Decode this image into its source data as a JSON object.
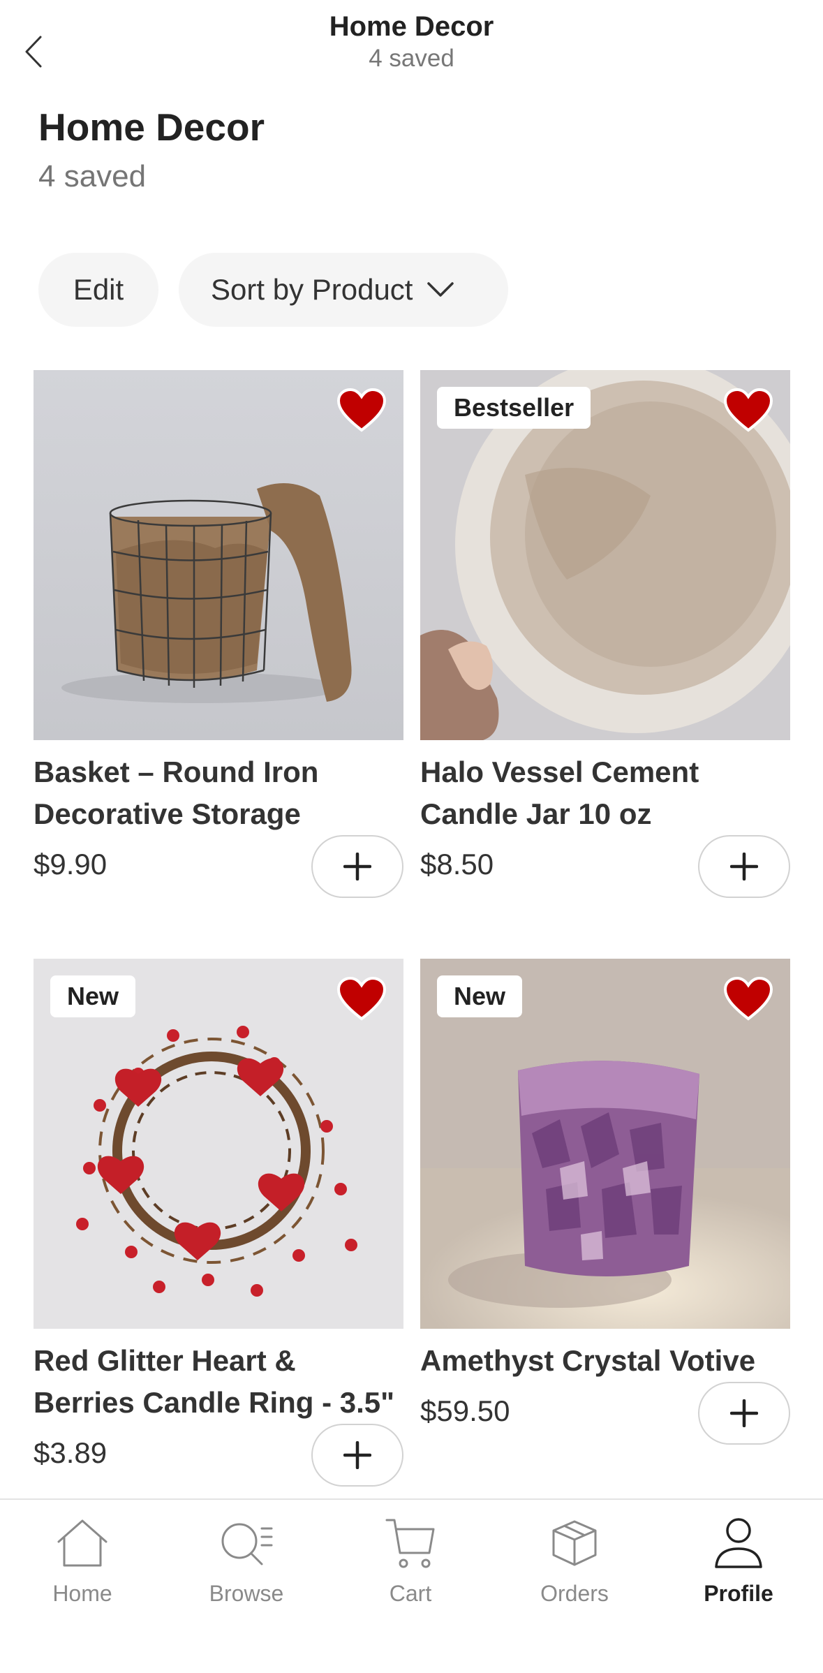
{
  "topnav": {
    "title": "Home Decor",
    "subtitle": "4 saved"
  },
  "header": {
    "title": "Home Decor",
    "subtitle": "4 saved"
  },
  "actions": {
    "edit_label": "Edit",
    "sort_label": "Sort by Product"
  },
  "products": [
    {
      "title": "Basket – Round Iron Decorative Storage",
      "price": "$9.90",
      "badge": "",
      "favorited": true
    },
    {
      "title": "Halo Vessel Cement Candle Jar 10 oz",
      "price": "$8.50",
      "badge": "Bestseller",
      "favorited": true
    },
    {
      "title": "Red Glitter Heart & Berries Candle Ring - 3.5\"",
      "price": "$3.89",
      "badge": "New",
      "favorited": true
    },
    {
      "title": "Amethyst Crystal Votive",
      "price": "$59.50",
      "badge": "New",
      "favorited": true
    }
  ],
  "tabbar": {
    "items": [
      {
        "label": "Home",
        "icon": "home-icon",
        "active": false
      },
      {
        "label": "Browse",
        "icon": "browse-icon",
        "active": false
      },
      {
        "label": "Cart",
        "icon": "cart-icon",
        "active": false
      },
      {
        "label": "Orders",
        "icon": "orders-icon",
        "active": false
      },
      {
        "label": "Profile",
        "icon": "profile-icon",
        "active": true
      }
    ]
  },
  "colors": {
    "heart": "#c00000",
    "pill_bg": "#f5f5f5",
    "text_primary": "#222222",
    "text_secondary": "#757575"
  }
}
